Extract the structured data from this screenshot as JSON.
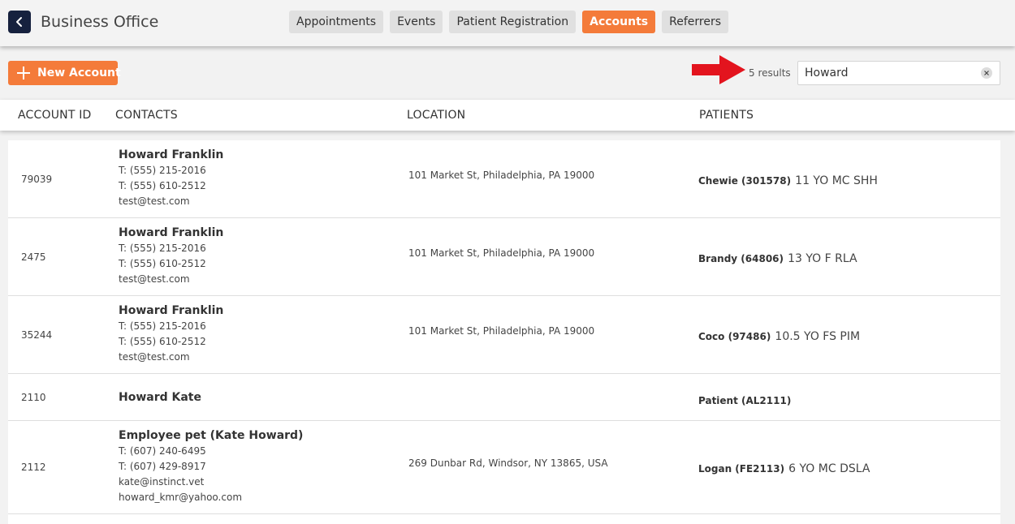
{
  "header": {
    "title": "Business Office",
    "tabs": [
      {
        "label": "Appointments"
      },
      {
        "label": "Events"
      },
      {
        "label": "Patient Registration"
      },
      {
        "label": "Accounts",
        "active": true
      },
      {
        "label": "Referrers"
      }
    ]
  },
  "toolbar": {
    "new_account_label": "New Account",
    "results_text": "5 results",
    "search_value": "Howard"
  },
  "table": {
    "columns": [
      "ACCOUNT ID",
      "CONTACTS",
      "LOCATION",
      "PATIENTS"
    ],
    "rows": [
      {
        "id": "79039",
        "contact_name": "Howard Franklin",
        "lines": [
          "T: (555) 215-2016",
          "T: (555) 610-2512",
          "test@test.com"
        ],
        "location": "101 Market St, Philadelphia, PA 19000",
        "patient": "Chewie (301578)",
        "patient_desc": "11 YO MC SHH"
      },
      {
        "id": "2475",
        "contact_name": "Howard Franklin",
        "lines": [
          "T: (555) 215-2016",
          "T: (555) 610-2512",
          "test@test.com"
        ],
        "location": "101 Market St, Philadelphia, PA 19000",
        "patient": "Brandy (64806)",
        "patient_desc": "13 YO F RLA"
      },
      {
        "id": "35244",
        "contact_name": "Howard Franklin",
        "lines": [
          "T: (555) 215-2016",
          "T: (555) 610-2512",
          "test@test.com"
        ],
        "location": "101 Market St, Philadelphia, PA 19000",
        "patient": "Coco (97486)",
        "patient_desc": "10.5 YO FS PIM"
      },
      {
        "id": "2110",
        "contact_name": "Howard Kate",
        "lines": [],
        "location": "",
        "patient": "Patient (AL2111)",
        "patient_desc": ""
      },
      {
        "id": "2112",
        "contact_name": "Employee pet (Kate Howard)",
        "lines": [
          "T: (607) 240-6495",
          "T: (607) 429-8917",
          "kate@instinct.vet",
          "howard_kmr@yahoo.com"
        ],
        "location": "269 Dunbar Rd, Windsor, NY 13865, USA",
        "patient": "Logan (FE2113)",
        "patient_desc": "6 YO MC DSLA"
      }
    ]
  },
  "colors": {
    "accent": "#f47b3a",
    "back_button": "#16213e",
    "arrow": "#e3141e"
  },
  "icons": [
    "chevron-left-icon",
    "plus-icon",
    "red-arrow-icon",
    "clear-icon"
  ]
}
